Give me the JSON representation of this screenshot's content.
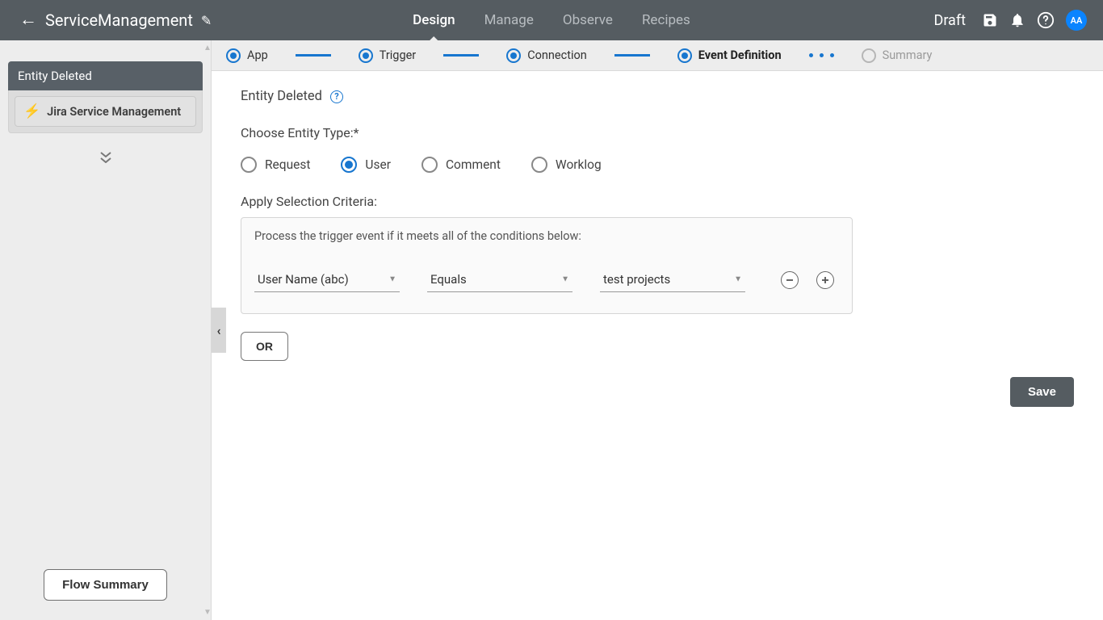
{
  "header": {
    "title": "ServiceManagement",
    "tabs": {
      "design": "Design",
      "manage": "Manage",
      "observe": "Observe",
      "recipes": "Recipes"
    },
    "status": "Draft",
    "avatar": "AA"
  },
  "sidebar": {
    "node_title": "Entity Deleted",
    "connector": "Jira Service Management",
    "flow_summary": "Flow Summary"
  },
  "wizard": {
    "steps": {
      "app": "App",
      "trigger": "Trigger",
      "connection": "Connection",
      "event_def": "Event Definition",
      "summary": "Summary"
    }
  },
  "form": {
    "section_title": "Entity Deleted",
    "entity_type_label": "Choose Entity Type:*",
    "entity_options": {
      "request": "Request",
      "user": "User",
      "comment": "Comment",
      "worklog": "Worklog"
    },
    "criteria_label": "Apply Selection Criteria:",
    "criteria_desc": "Process the trigger event if it meets all of the conditions below:",
    "criteria_row": {
      "field": "User Name (abc)",
      "operator": "Equals",
      "value": "test projects"
    },
    "or_button": "OR",
    "save_button": "Save"
  }
}
